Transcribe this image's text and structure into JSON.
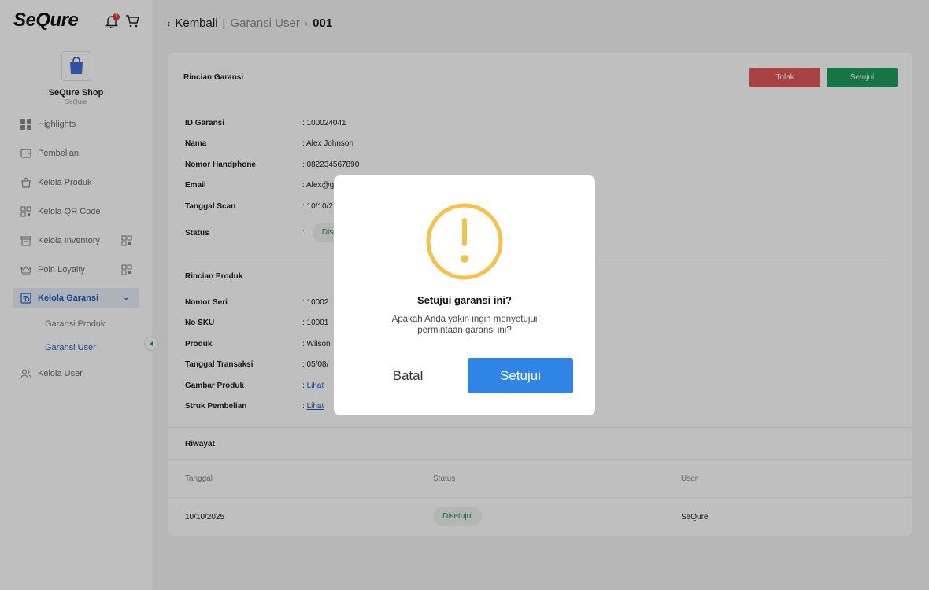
{
  "app": {
    "logo": "SeQure",
    "notification_count": "1"
  },
  "shop": {
    "name": "SeQure Shop",
    "subtitle": "SeQure"
  },
  "sidebar": {
    "items": [
      {
        "label": "Highlights",
        "icon": "grid-icon"
      },
      {
        "label": "Pembelian",
        "icon": "wallet-icon"
      },
      {
        "label": "Kelola Produk",
        "icon": "bag-icon"
      },
      {
        "label": "Kelola QR Code",
        "icon": "qr-icon"
      },
      {
        "label": "Kelola Inventory",
        "icon": "box-icon"
      },
      {
        "label": "Poin Loyalty",
        "icon": "crown-icon"
      },
      {
        "label": "Kelola Garansi",
        "icon": "warranty-icon"
      },
      {
        "label": "Kelola User",
        "icon": "users-icon"
      }
    ],
    "sub_items": [
      {
        "label": "Garansi Produk"
      },
      {
        "label": "Garansi User"
      }
    ]
  },
  "breadcrumb": {
    "back": "Kembali",
    "separator": "|",
    "section": "Garansi User",
    "id": "001"
  },
  "warranty": {
    "title": "Rincian Garansi",
    "reject_label": "Tolak",
    "approve_label": "Setujui",
    "rows": [
      {
        "label": "ID Garansi",
        "value": ": 100024041"
      },
      {
        "label": "Nama",
        "value": ": Alex Johnson"
      },
      {
        "label": "Nomor Handphone",
        "value": ": 082234567890"
      },
      {
        "label": "Email",
        "value": ": Alex@g"
      },
      {
        "label": "Tanggal Scan",
        "value": ": 10/10/2"
      }
    ],
    "status_label": "Status",
    "status_colon": ":",
    "status_value": "Dise"
  },
  "product": {
    "title": "Rincian Produk",
    "rows": [
      {
        "label": "Nomor Seri",
        "value": ": 10002"
      },
      {
        "label": "No SKU",
        "value": ": 10001"
      },
      {
        "label": "Produk",
        "value": ": Wilson"
      },
      {
        "label": "Tanggal Transaksi",
        "value": ": 05/08/"
      }
    ],
    "image_label": "Gambar Produk",
    "receipt_label": "Struk Pembelian",
    "colon": ":",
    "link_text": "Lihat"
  },
  "history": {
    "title": "Riwayat",
    "columns": [
      "Tanggal",
      "Status",
      "User"
    ],
    "rows": [
      {
        "date": "10/10/2025",
        "status": "Disetujui",
        "user": "SeQure"
      }
    ]
  },
  "modal": {
    "title": "Setujui garansi ini?",
    "description": "Apakah Anda yakin ingin menyetujui permintaan garansi ini?",
    "cancel_label": "Batal",
    "confirm_label": "Setujui",
    "warning_color": "#f7c04a"
  }
}
